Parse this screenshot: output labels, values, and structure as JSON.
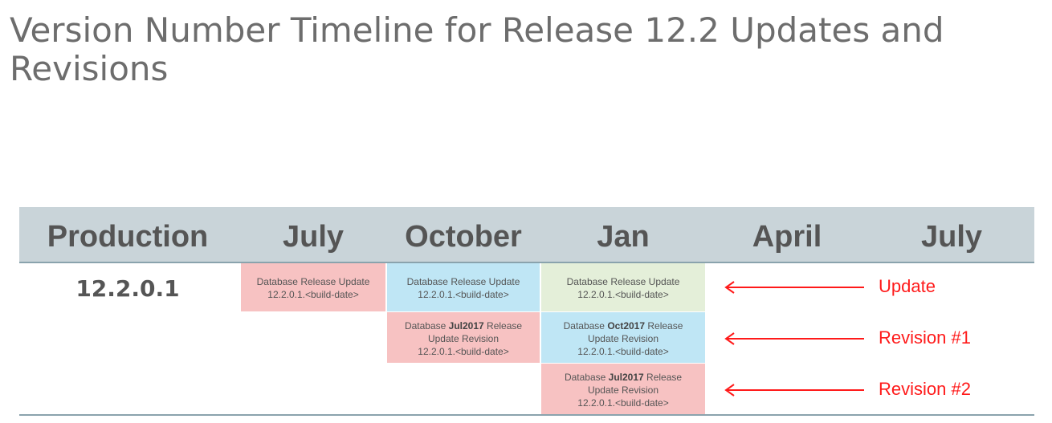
{
  "title": "Version Number Timeline for Release 12.2 Updates and Revisions",
  "columns": [
    "Production",
    "July",
    "October",
    "Jan",
    "April",
    "July"
  ],
  "production_version": "12.2.0.1",
  "cells": {
    "july_update": {
      "line1": "Database Release Update",
      "line2": "12.2.0.1.<build-date>"
    },
    "oct_update": {
      "line1": "Database Release Update",
      "line2": "12.2.0.1.<build-date>"
    },
    "jan_update": {
      "line1": "Database Release Update",
      "line2": "12.2.0.1.<build-date>"
    },
    "oct_rev1": {
      "pre": "Database ",
      "bold": "Jul2017",
      "post": " Release",
      "line2": "Update Revision",
      "line3": "12.2.0.1.<build-date>"
    },
    "jan_rev1": {
      "pre": "Database ",
      "bold": "Oct2017",
      "post": " Release",
      "line2": "Update Revision",
      "line3": "12.2.0.1.<build-date>"
    },
    "jan_rev2": {
      "pre": "Database ",
      "bold": "Jul2017",
      "post": " Release",
      "line2": "Update Revision",
      "line3": "12.2.0.1.<build-date>"
    }
  },
  "labels": [
    "Update",
    "Revision #1",
    "Revision #2"
  ],
  "colors": {
    "pink": "#f7c2c2",
    "blue": "#bfe6f5",
    "green": "#e4efd9",
    "arrow": "#ff1a1a",
    "header": "#c9d4d9"
  }
}
